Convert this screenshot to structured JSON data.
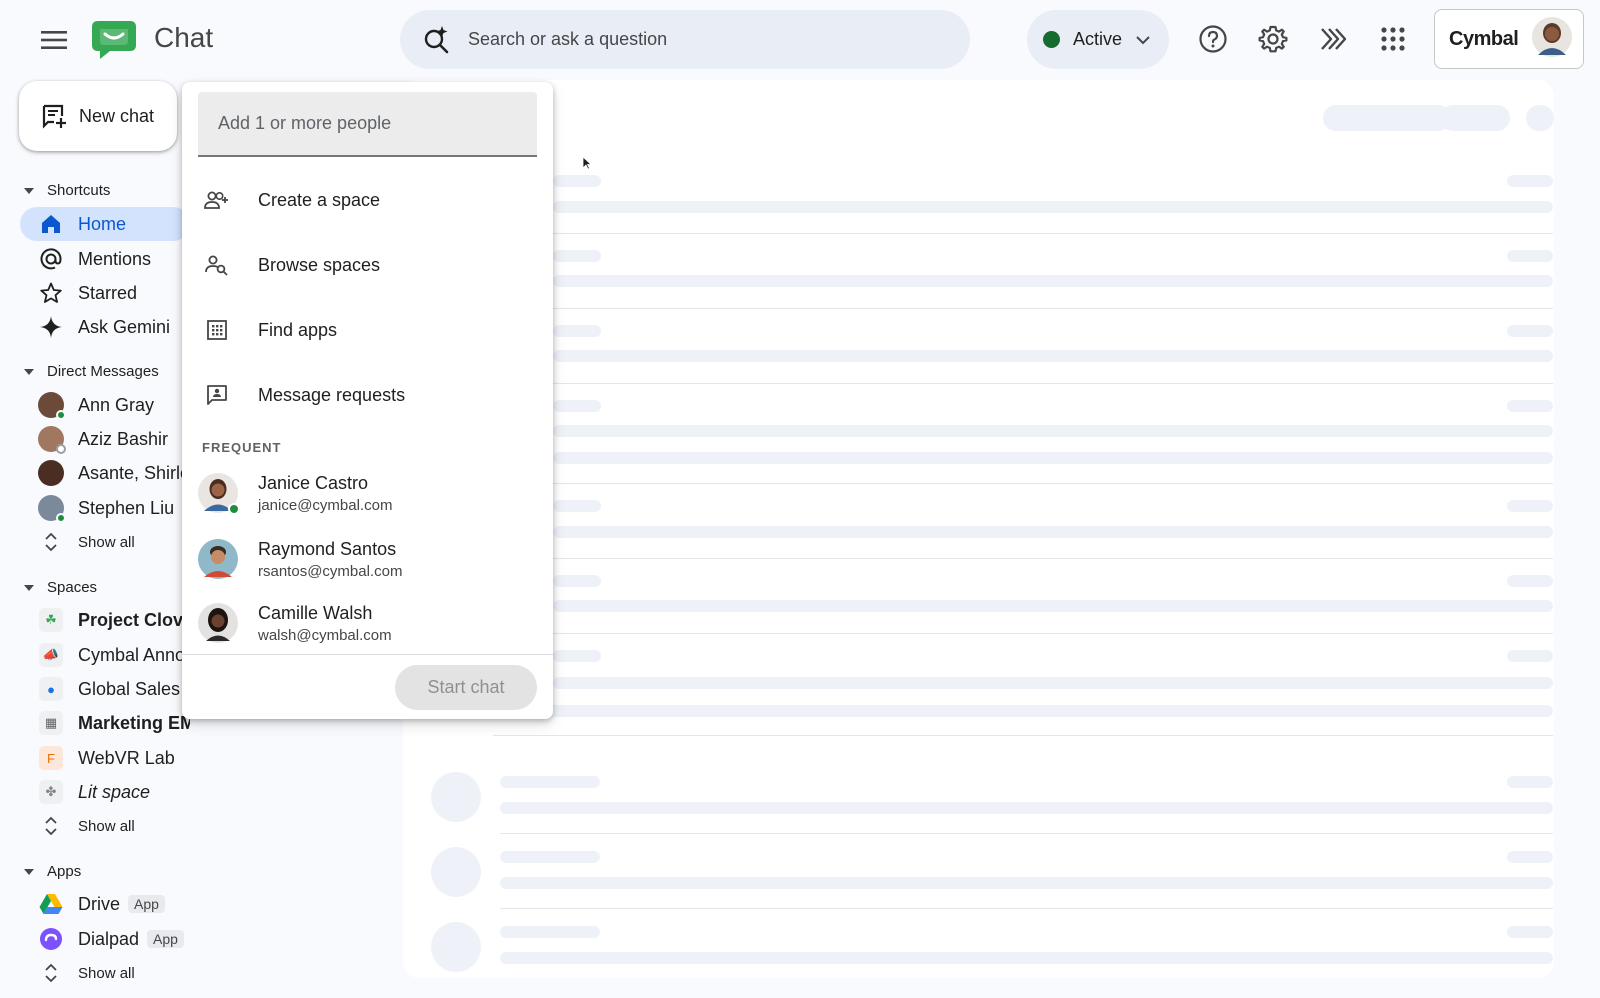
{
  "header": {
    "app_title": "Chat",
    "search_placeholder": "Search or ask a question",
    "status_label": "Active",
    "org_brand": "Cymbal",
    "icons": [
      "menu-icon",
      "help-icon",
      "settings-icon",
      "gemini-sparkle-icon",
      "apps-grid-icon"
    ]
  },
  "nav": {
    "new_chat_label": "New chat",
    "shortcuts": {
      "title": "Shortcuts",
      "items": [
        {
          "label": "Home",
          "icon": "home-icon",
          "active": true
        },
        {
          "label": "Mentions",
          "icon": "at-icon"
        },
        {
          "label": "Starred",
          "icon": "star-icon"
        },
        {
          "label": "Ask Gemini",
          "icon": "gemini-icon"
        }
      ]
    },
    "direct_messages": {
      "title": "Direct Messages",
      "items": [
        {
          "label": "Ann Gray",
          "presence": "online"
        },
        {
          "label": "Aziz Bashir",
          "presence": "away"
        },
        {
          "label": "Asante, Shirle",
          "presence": "none"
        },
        {
          "label": "Stephen Liu",
          "presence": "online"
        }
      ],
      "show_all": "Show all"
    },
    "spaces": {
      "title": "Spaces",
      "items": [
        {
          "label": "Project Clov",
          "style": "bold"
        },
        {
          "label": "Cymbal Anno",
          "style": "normal"
        },
        {
          "label": "Global Sales",
          "style": "normal"
        },
        {
          "label": "Marketing EMEA",
          "style": "bold"
        },
        {
          "label": "WebVR Lab",
          "style": "normal",
          "letter": "F"
        },
        {
          "label": "Lit space",
          "style": "italic"
        }
      ],
      "show_all": "Show all"
    },
    "apps": {
      "title": "Apps",
      "items": [
        {
          "label": "Drive",
          "badge": "App"
        },
        {
          "label": "Dialpad",
          "badge": "App"
        }
      ],
      "show_all": "Show all"
    }
  },
  "dropdown": {
    "input_placeholder": "Add 1 or more people",
    "actions": [
      {
        "label": "Create a space",
        "icon": "group-add-icon"
      },
      {
        "label": "Browse spaces",
        "icon": "group-search-icon"
      },
      {
        "label": "Find apps",
        "icon": "apps-box-icon"
      },
      {
        "label": "Message requests",
        "icon": "message-request-icon"
      }
    ],
    "frequent_title": "FREQUENT",
    "contacts": [
      {
        "name": "Janice Castro",
        "email": "janice@cymbal.com",
        "online": true
      },
      {
        "name": "Raymond Santos",
        "email": "rsantos@cymbal.com",
        "online": false
      },
      {
        "name": "Camille Walsh",
        "email": "walsh@cymbal.com",
        "online": false
      }
    ],
    "start_chat_label": "Start chat"
  },
  "colors": {
    "accent_active_bg": "#d3e3fd",
    "status_green": "#146c2e",
    "search_bg": "#e9eef6",
    "logo_green": "#34a853"
  }
}
